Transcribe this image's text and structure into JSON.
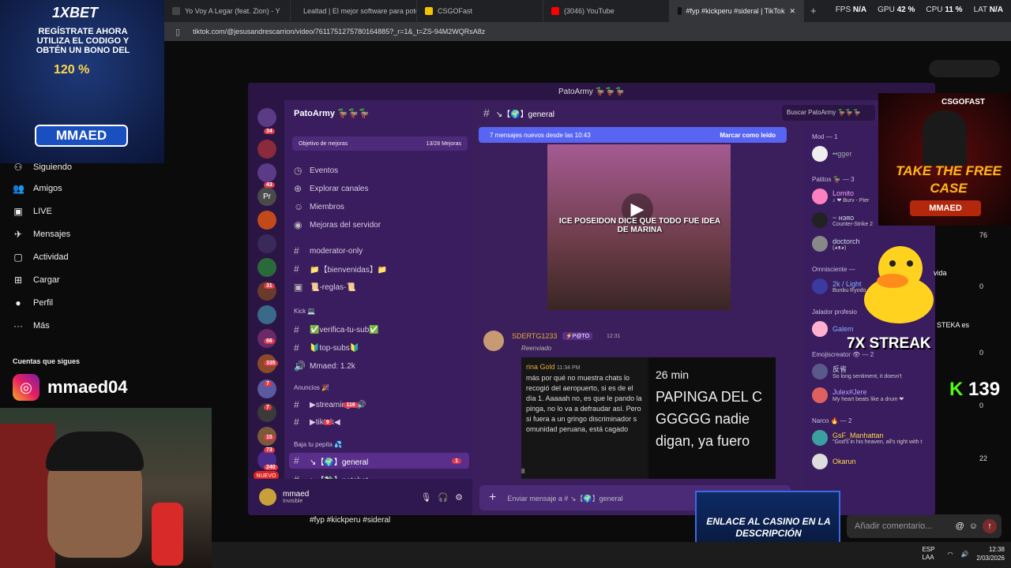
{
  "browser": {
    "tabs": [
      {
        "label": "Yo Voy A Legar (feat. Zion) - Y",
        "color": "#444"
      },
      {
        "label": "Lealtad | El mejor software para pote",
        "color": "#888"
      },
      {
        "label": "CSGOFast",
        "color": "#f5c400"
      },
      {
        "label": "(3046) YouTube",
        "color": "#ff0000"
      },
      {
        "label": "#fyp #kickperu #sideral | TikTok",
        "color": "#111",
        "active": true
      }
    ],
    "close_glyph": "✕",
    "new_tab_glyph": "+",
    "url": "tiktok.com/@jesusandrescarrion/video/7611751275780164885?_r=1&_t=ZS-94M2WQRsA8z",
    "stats": {
      "fps_label": "FPS",
      "fps": "N/A",
      "gpu_label": "GPU",
      "gpu": "42 %",
      "cpu_label": "CPU",
      "cpu": "11 %",
      "lat_label": "LAT",
      "lat": "N/A"
    }
  },
  "ad": {
    "logo": "1XBET",
    "text": "REGÍSTRATE AHORA UTILIZA EL CODIGO Y OBTÉN UN BONO DEL",
    "percent": "120 %",
    "code": "MMAED"
  },
  "tiktok": {
    "nav": [
      {
        "label": "Siguiendo",
        "icon": "following-icon",
        "glyph": "⚇"
      },
      {
        "label": "Amigos",
        "icon": "friends-icon",
        "glyph": "👥"
      },
      {
        "label": "LIVE",
        "icon": "live-icon",
        "glyph": "▣"
      },
      {
        "label": "Mensajes",
        "icon": "messages-icon",
        "glyph": "✈"
      },
      {
        "label": "Actividad",
        "icon": "activity-icon",
        "glyph": "▢"
      },
      {
        "label": "Cargar",
        "icon": "upload-icon",
        "glyph": "⊞"
      },
      {
        "label": "Perfil",
        "icon": "profile-icon",
        "glyph": "●"
      },
      {
        "label": "Más",
        "icon": "more-icon",
        "glyph": "···"
      }
    ],
    "following_title": "Cuentas que sigues",
    "account": "mmaed04",
    "tags": "#fyp #kickperu #sideral",
    "comment_placeholder": "Añadir comentario..."
  },
  "discord": {
    "window_title": "PatoArmy 🦆🦆🦆",
    "server_name": "PatoArmy 🦆🦆🦆",
    "boost": {
      "label": "Objetivo de mejoras",
      "progress": "13/28 Mejoras"
    },
    "menu": [
      "Eventos",
      "Explorar canales",
      "Miembros",
      "Mejoras del servidor"
    ],
    "channels": [
      {
        "label": "moderator-only",
        "prefix": "#"
      },
      {
        "label": "📁【bienvenidas】📁",
        "prefix": "#"
      },
      {
        "label": "📜-reglas-📜",
        "prefix": "▣"
      },
      {
        "label": "Kick 💻",
        "prefix": "",
        "category": true
      },
      {
        "label": "✅verifica-tu-sub✅",
        "prefix": "#"
      },
      {
        "label": "🔰top-subs🔰",
        "prefix": "#"
      },
      {
        "label": "Mmaed: 1.2k",
        "prefix": "🔊"
      },
      {
        "label": "Anuncios 🎉",
        "prefix": "",
        "category": true
      },
      {
        "label": "▶streaming◀🔊",
        "prefix": "#",
        "badge": "116"
      },
      {
        "label": "▶tiktok◀",
        "prefix": "#",
        "badge": "9"
      },
      {
        "label": "Baja tu pepita 💦",
        "prefix": "",
        "category": true
      },
      {
        "label": "↘【🌍】general",
        "prefix": "#",
        "badge": "1",
        "selected": true
      },
      {
        "label": "↘【💸】patobet",
        "prefix": "#"
      }
    ],
    "server_badges": [
      "34",
      "43",
      "31",
      "66",
      "335",
      "7",
      "7",
      "15",
      "73",
      "240"
    ],
    "server_new_label": "NUEVO",
    "server_pr": "Pr",
    "user": {
      "name": "mmaed",
      "status": "Invisible"
    },
    "chat_header": "↘【🌍】general",
    "search_placeholder": "Buscar PatoArmy 🦆🦆🦆",
    "new_messages": {
      "label": "7 mensajes nuevos desde las 10:43",
      "action": "Marcar como leído"
    },
    "video_caption": "ICE POSEIDON DICE QUE TODO FUE IDEA DE MARINA",
    "play_glyph": "▶",
    "message": {
      "author": "SDERTG1233",
      "tag": "⚡P@TO",
      "time": "12:31",
      "forwarded": "Reenviado",
      "shot_left_name": "rina Gold",
      "shot_left_time": "11:34 PM",
      "shot_left_body": "más por qué no muestra chats lo recogió del aeropuerto, si es de el día 1. Aaaaah no, es que le pando la pinga, no lo va a defraudar así. Pero si fuera a un gringo discriminador s omunidad peruana, está cagado",
      "shot_right_time": "26 min",
      "shot_right_body": "PAPINGA DEL C GGGGG nadie digan, ya fuero",
      "reaction_count": "8"
    },
    "composer_placeholder": "Enviar mensaje a # ↘【🌍】general",
    "members": {
      "groups": [
        {
          "label": "Mod — 1",
          "items": [
            {
              "name": "••gger",
              "sub": "",
              "color": "#9aa"
            }
          ]
        },
        {
          "label": "Patitos 🦆 — 3",
          "items": [
            {
              "name": "Lomito",
              "sub": "♪ ❤ Burv - Pier",
              "color": "#f0a0ff"
            },
            {
              "name": "~ нэяо",
              "sub": "Counter-Strike 2",
              "color": "#cde"
            },
            {
              "name": "doctorch",
              "sub": "(◕ᴥ◕)",
              "color": "#cde"
            }
          ]
        },
        {
          "label": "Omnisciente —",
          "items": [
            {
              "name": "2k / Light",
              "sub": "Bunbu Ryodo",
              "color": "#7fb2ff"
            }
          ]
        },
        {
          "label": "Jalador profesio",
          "items": [
            {
              "name": "Galem",
              "sub": "",
              "color": "#7fb2ff"
            }
          ]
        },
        {
          "label": "Emojiscreator 👁 — 2",
          "items": [
            {
              "name": "反省",
              "sub": "So long sentiment, it doesn't",
              "color": "#cde"
            },
            {
              "name": "Julex#Jere",
              "sub": "My heart beats like a drum ❤",
              "color": "#b9a2ff"
            }
          ]
        },
        {
          "label": "Narco 🔥 — 2",
          "items": [
            {
              "name": "GsF_Manhattan",
              "sub": "\"God's in his heaven, all's right with t",
              "color": "#ffd84a"
            },
            {
              "name": "Okarun",
              "sub": "",
              "color": "#ffd84a"
            }
          ]
        }
      ]
    }
  },
  "overlays": {
    "csgo_brand": "CSGOFAST",
    "csgo_free": "TAKE THE FREE CASE",
    "csgo_mmaed": "MMAED",
    "streak": "7X STREAK",
    "kick_count": "139",
    "right_counts": [
      "76",
      "0",
      "0",
      "0",
      "22"
    ],
    "right_text_1": "vida",
    "right_text_2": "STEKA es",
    "casino": "ENLACE AL CASINO EN LA DESCRIPCIÓN"
  },
  "taskbar": {
    "lang": "ESP LAA",
    "time": "12:38",
    "date": "2/03/2026"
  },
  "colors": {
    "discord_bg": "#3b1f5c",
    "blurple": "#5865f2",
    "badge": "#e0394a",
    "kick_green": "#53fc18"
  }
}
